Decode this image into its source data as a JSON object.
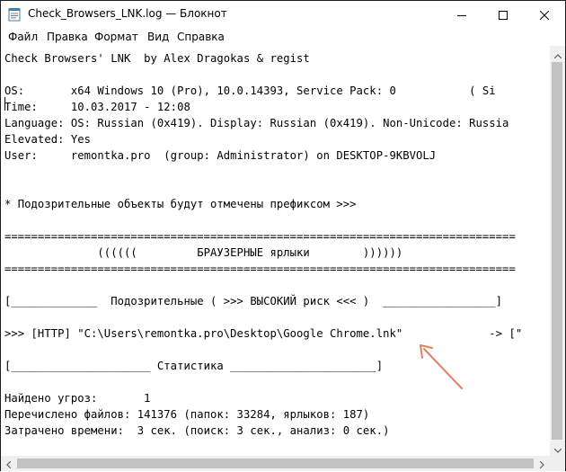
{
  "window": {
    "title": "Check_Browsers_LNK.log — Блокнот",
    "app_icon": "notepad-icon",
    "caption_buttons": [
      "minimize-icon",
      "maximize-icon",
      "close-icon"
    ]
  },
  "menu": [
    "Файл",
    "Правка",
    "Формат",
    "Вид",
    "Справка"
  ],
  "lines": [
    "Check Browsers' LNK  by Alex Dragokas & regist",
    "",
    "OS:       x64 Windows 10 (Pro), 10.0.14393, Service Pack: 0           ( Si",
    "Time:     10.03.2017 - 12:08",
    "Language: OS: Russian (0x419). Display: Russian (0x419). Non-Unicode: Russia",
    "Elevated: Yes",
    "User:     remontka.pro  (group: Administrator) on DESKTOP-9KBVOLJ",
    "",
    "",
    "* Подозрительные объекты будут отмечены префиксом >>>",
    "",
    "=============================================================================",
    "              ((((((         БРАУЗЕРНЫЕ ярлыки        ))))))",
    "=============================================================================",
    "",
    "[_____________  Подозрительные ( >>> ВЫСОКИЙ риск <<< )  _________________]",
    "",
    ">>> [HTTP] \"C:\\Users\\remontka.pro\\Desktop\\Google Chrome.lnk\"             -> [\"",
    "",
    "[_____________________ Статистика ______________________]",
    "",
    "Найдено угроз:       1",
    "Перечислено файлов: 141376 (папок: 33284, ярлыков: 187)",
    "Затрачено времени:  3 сек. (поиск: 3 сек., анализ: 0 сек.)"
  ],
  "scrollbars": {
    "vertical": [
      "scroll-up-arrow-icon",
      "scroll-down-arrow-icon"
    ],
    "horizontal": [
      "scroll-left-arrow-icon",
      "scroll-right-arrow-icon"
    ]
  },
  "annotation": {
    "icon": "red-arrow-annotation-icon",
    "color": "#e08060"
  }
}
